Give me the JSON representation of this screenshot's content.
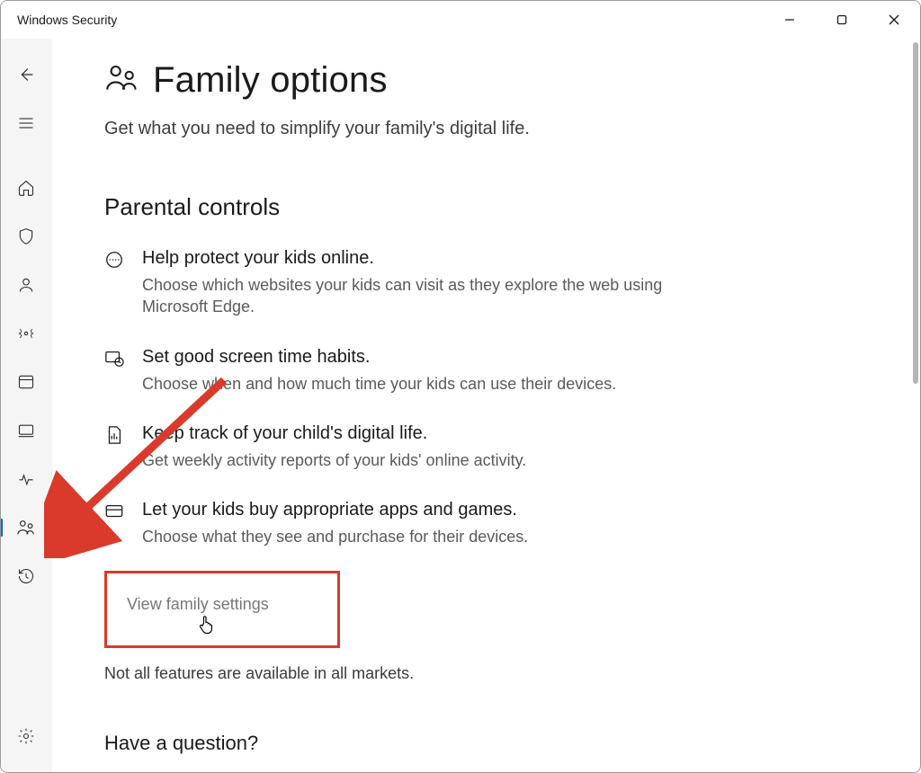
{
  "window": {
    "title": "Windows Security"
  },
  "page": {
    "title": "Family options",
    "subtitle": "Get what you need to simplify your family's digital life."
  },
  "section": {
    "title": "Parental controls"
  },
  "features": [
    {
      "title": "Help protect your kids online.",
      "desc": "Choose which websites your kids can visit as they explore the web using Microsoft Edge."
    },
    {
      "title": "Set good screen time habits.",
      "desc": "Choose when and how much time your kids can use their devices."
    },
    {
      "title": "Keep track of your child's digital life.",
      "desc": "Get weekly activity reports of your kids' online activity."
    },
    {
      "title": "Let your kids buy appropriate apps and games.",
      "desc": "Choose what they see and purchase for their devices."
    }
  ],
  "link": {
    "view_family_settings": "View family settings"
  },
  "disclaimer": "Not all features are available in all markets.",
  "question": "Have a question?",
  "annotation": {
    "highlight_color": "#d93a2b"
  }
}
